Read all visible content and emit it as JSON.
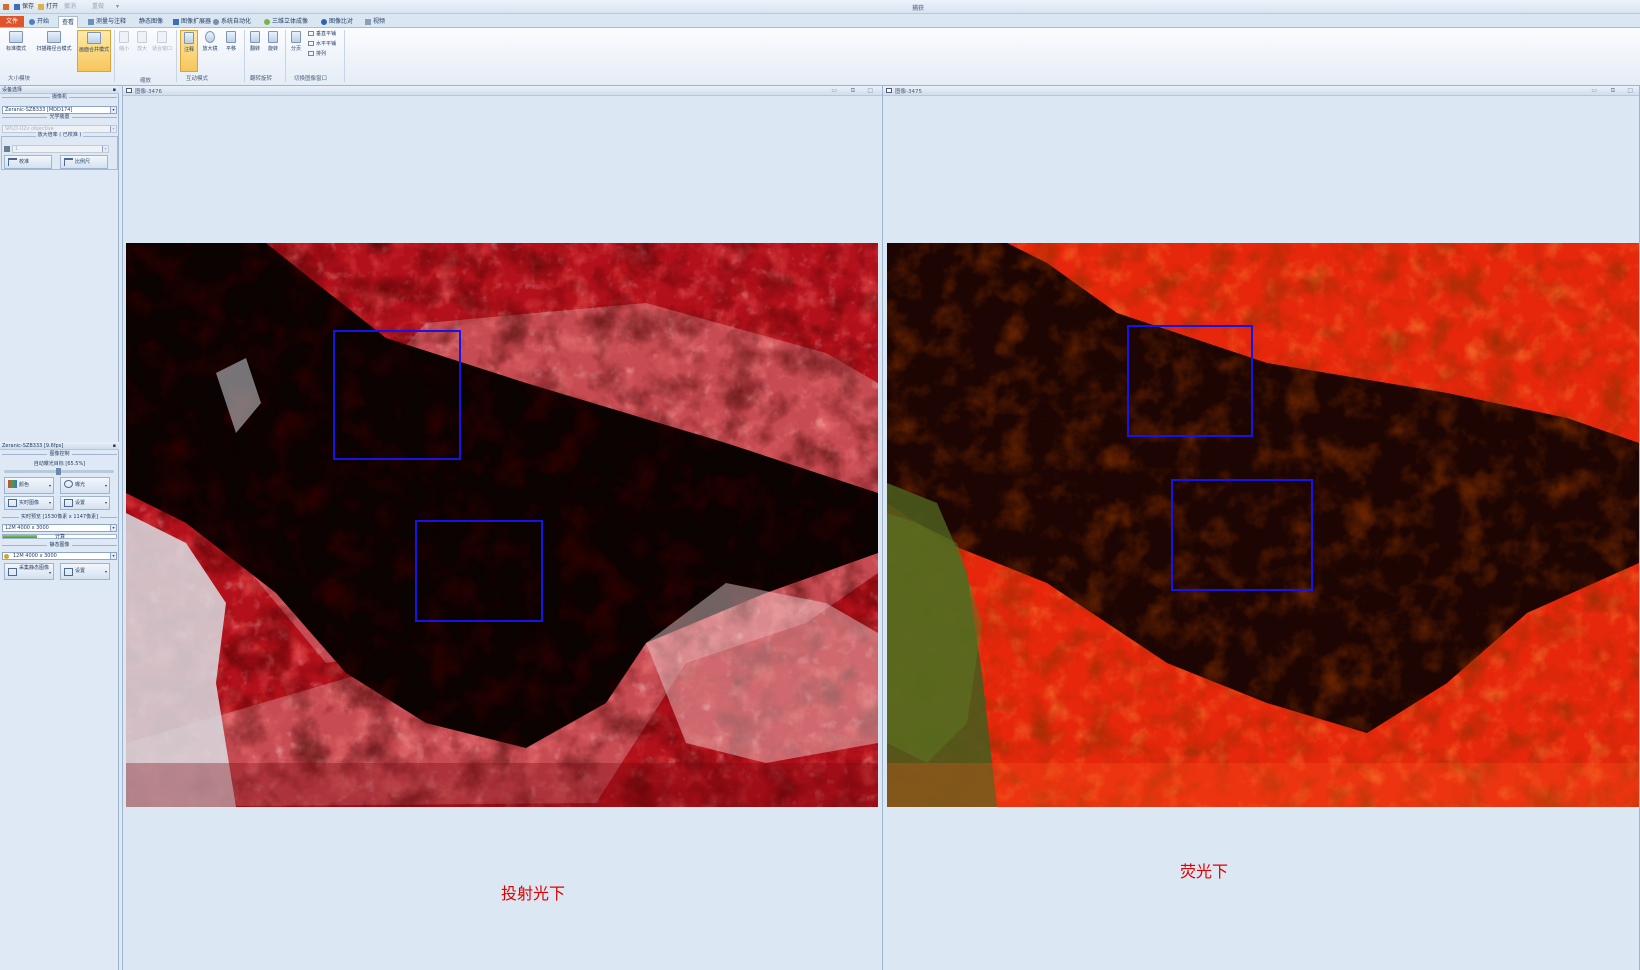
{
  "window_title": "捕获",
  "quick_access": {
    "save": "保存",
    "open": "打开",
    "dim1": "撤消",
    "dim2": "重做"
  },
  "ribbon_tabs": [
    "文件",
    "开始",
    "查看",
    "测量与注释",
    "静态图像",
    "图像扩展器",
    "系统自动化",
    "三维立体成像",
    "图像比对",
    "视频"
  ],
  "ribbon": {
    "group1": {
      "label": "大小模块",
      "buttons": [
        "标准模式",
        "扫描路径合模式",
        "画面合并模式"
      ]
    },
    "group2": {
      "label": "缩放",
      "buttons": [
        "缩小",
        "放大",
        "适合窗口"
      ]
    },
    "group3": {
      "label": "互动模式",
      "buttons": [
        "注释",
        "放大镜",
        "平移"
      ]
    },
    "group4": {
      "label": "翻转旋转",
      "buttons": [
        "翻转",
        "旋转"
      ]
    },
    "group5": {
      "label": "切换图像窗口",
      "buttons": [
        "分页"
      ],
      "small": [
        "垂直平铺",
        "水平平铺",
        "排列"
      ]
    }
  },
  "left_panel": {
    "device_header": "设备选择",
    "camera_group": "摄像机",
    "camera_value": "Zeranic-SZB333  [MDD174]",
    "optics_group": "光学装置",
    "optics_value": "SPLD-U2x objective",
    "mag_group": "放大倍率 ( 已校准 )",
    "mag_value": "1",
    "calibrate_btn": "校准",
    "scale_btn": "比例尺",
    "camera_header": "Zeranic-SZB333   [9.6fps]",
    "image_control_group": "图像控制",
    "auto_exposure": "自动曝光目标 [65.5%]",
    "color_btn": "颜色",
    "exposure_btn": "曝光",
    "live_btn": "实时图像",
    "settings_btn": "设置",
    "live_res_group": "实时预览 [1530像素 x 1147像素]",
    "live_res_value": "12M 4000 x 3000",
    "live_progress_label": "计算",
    "live_progress": 0.3,
    "still_group": "静态图像",
    "still_res_value": "12M 4000 x 3000",
    "capture_btn": "采集静态图像",
    "still_settings_btn": "设置"
  },
  "panes": {
    "left": {
      "title": "图像-3476",
      "caption": "投射光下"
    },
    "right": {
      "title": "图像-3475",
      "caption": "荧光下"
    }
  },
  "colors": {
    "roi_box": "#1414e6",
    "caption": "#e00000",
    "file_tab": "#e0542c"
  }
}
